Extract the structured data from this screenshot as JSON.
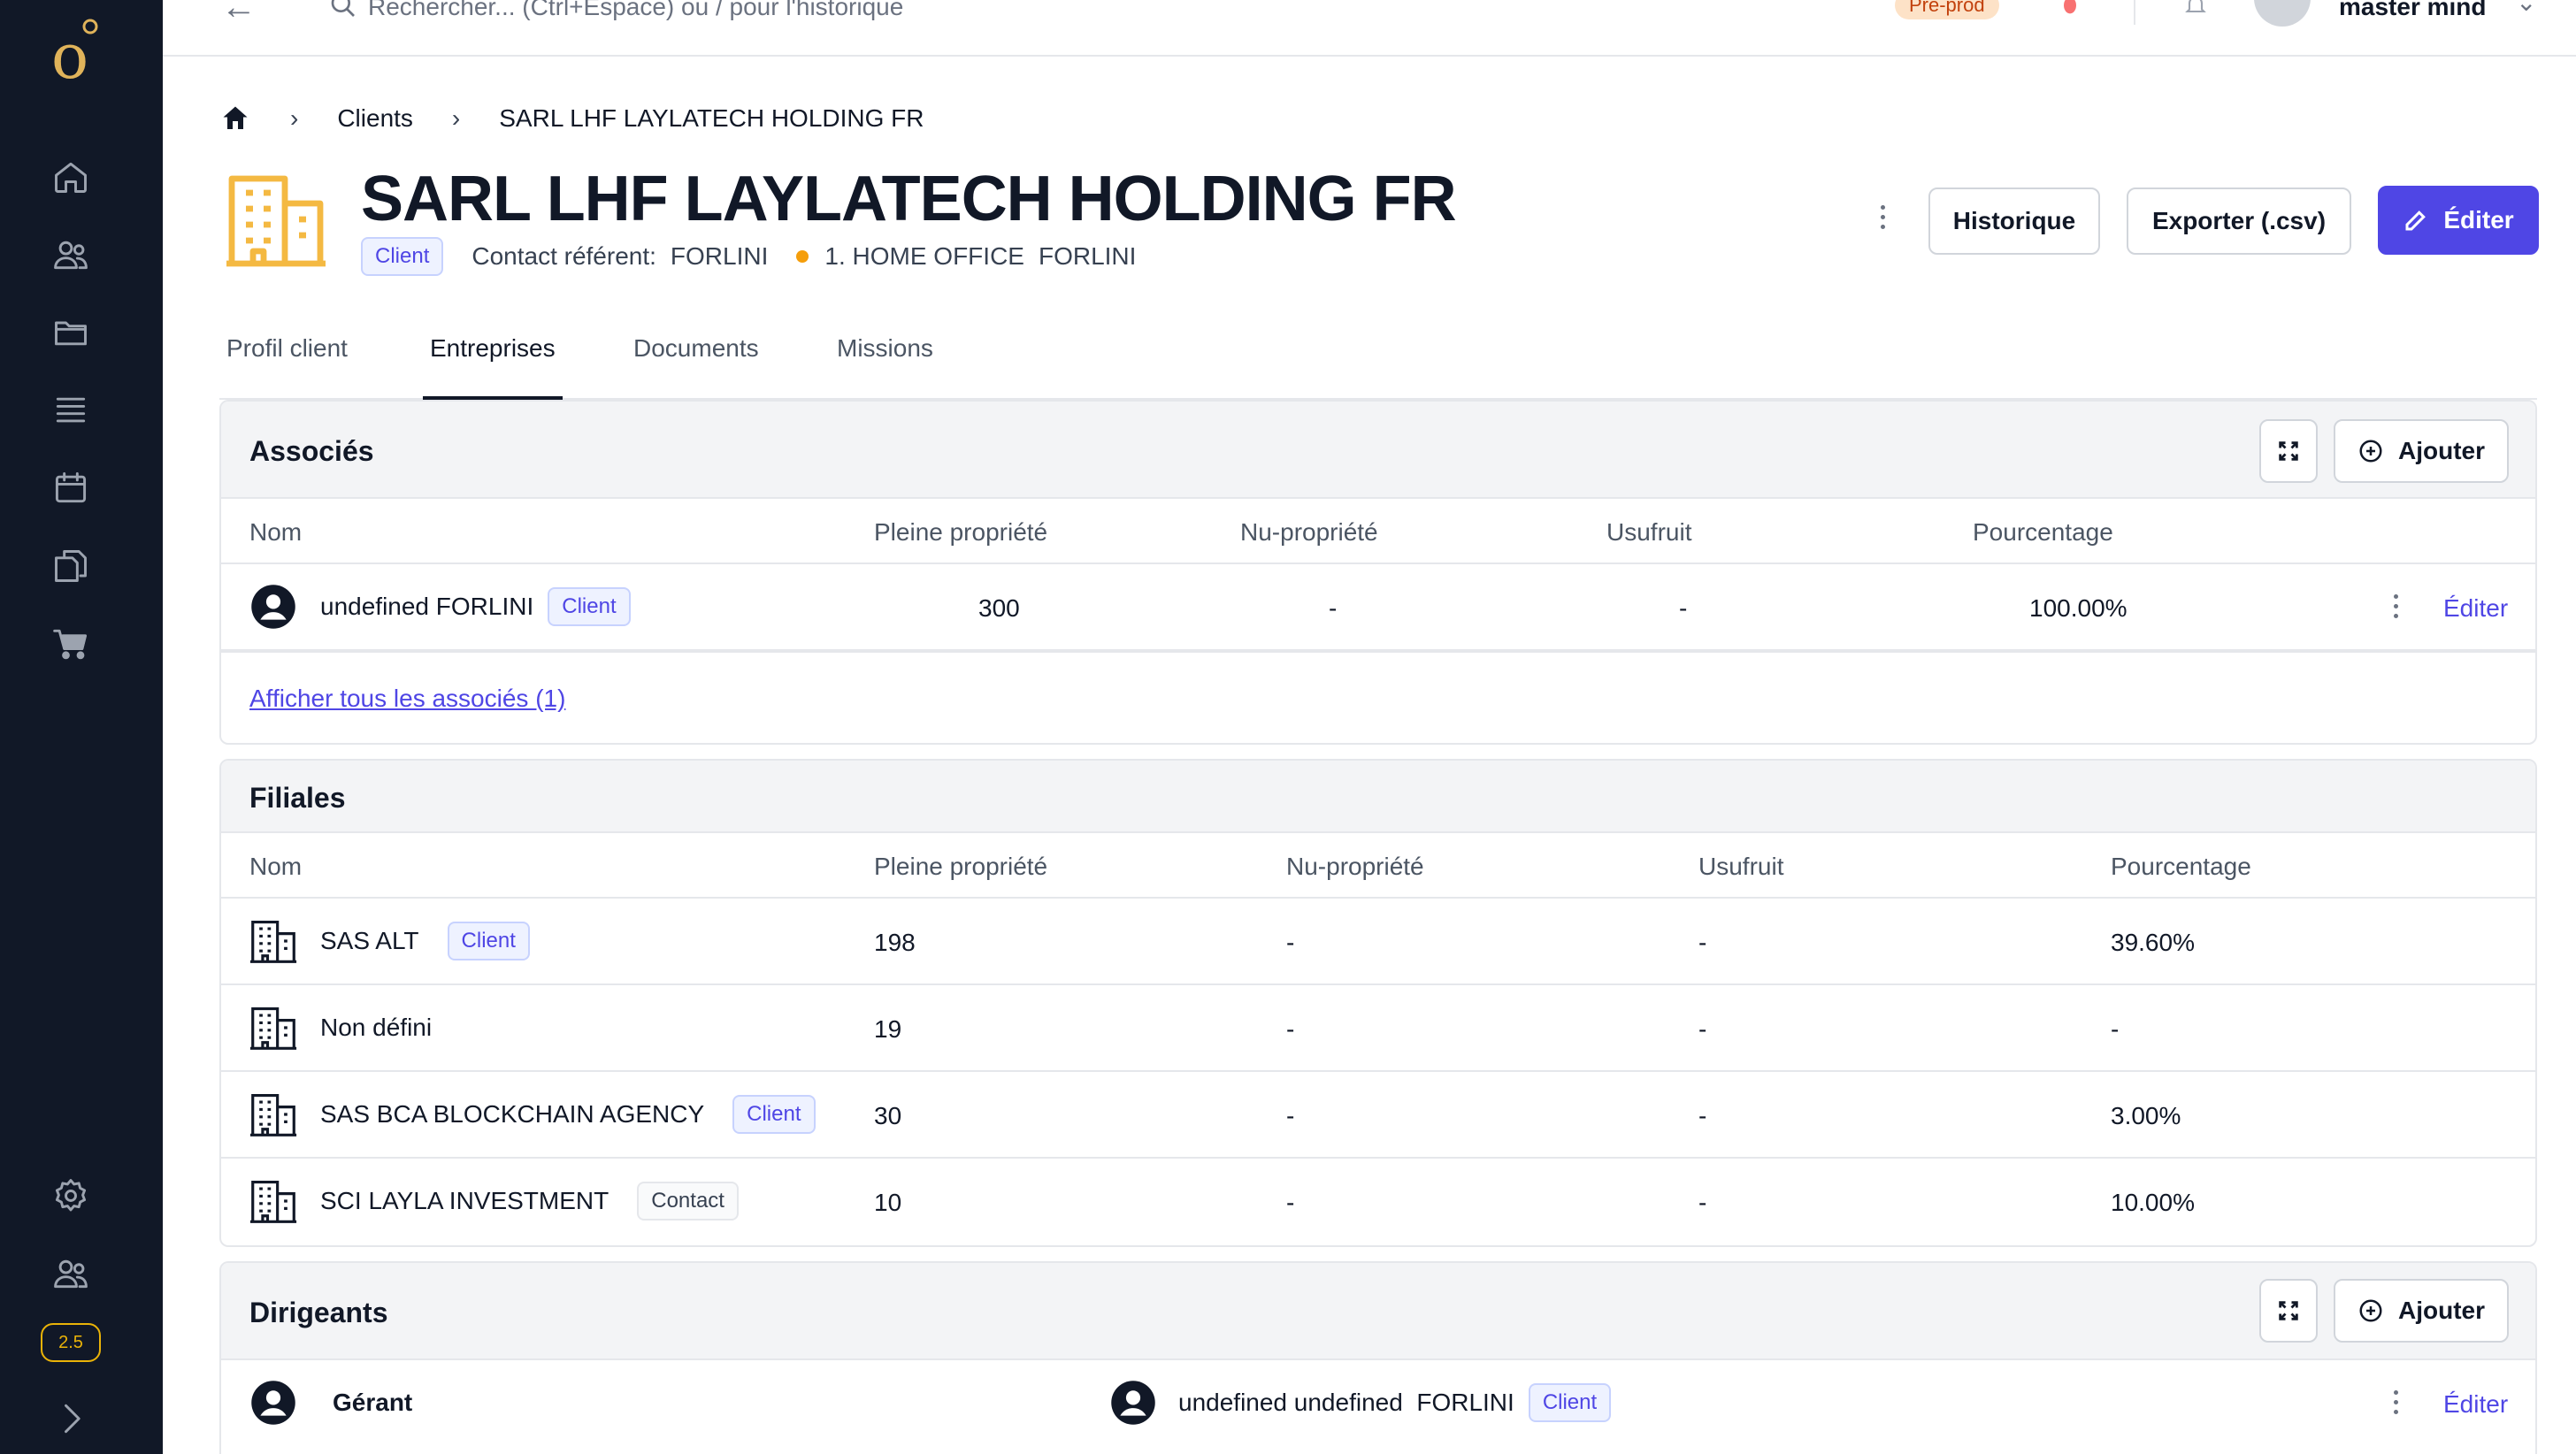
{
  "topbar": {
    "search_placeholder": "Rechercher... (Ctrl+Espace) ou / pour l'historique",
    "env_badge": "Pré-prod",
    "user_name": "master mind"
  },
  "sidebar": {
    "version": "2.5",
    "items": [
      "home-icon",
      "users-icon",
      "folder-icon",
      "list-icon",
      "calendar-icon",
      "documents-icon",
      "cart-icon",
      "gear-icon",
      "team-icon",
      "chevron-right-icon"
    ]
  },
  "breadcrumb": {
    "level1": "Clients",
    "level2": "SARL LHF LAYLATECH HOLDING FR"
  },
  "header": {
    "title": "SARL LHF LAYLATECH HOLDING FR",
    "badge": "Client",
    "contact_label": "Contact référent:",
    "contact_name": "FORLINI",
    "office_name": "1. HOME OFFICE",
    "office_person": "FORLINI",
    "btn_history": "Historique",
    "btn_export": "Exporter (.csv)",
    "btn_edit": "Éditer"
  },
  "tabs": [
    "Profil client",
    "Entreprises",
    "Documents",
    "Missions"
  ],
  "associes": {
    "title": "Associés",
    "add_label": "Ajouter",
    "columns": [
      "Nom",
      "Pleine propriété",
      "Nu-propriété",
      "Usufruit",
      "Pourcentage"
    ],
    "rows": [
      {
        "name": "undefined FORLINI",
        "badge": "Client",
        "pleine": "300",
        "nu": "-",
        "usufruit": "-",
        "pct": "100.00%",
        "action": "Éditer"
      }
    ],
    "show_all": "Afficher tous les associés (1)"
  },
  "filiales": {
    "title": "Filiales",
    "columns": [
      "Nom",
      "Pleine propriété",
      "Nu-propriété",
      "Usufruit",
      "Pourcentage"
    ],
    "rows": [
      {
        "name": "SAS ALT",
        "badge": "Client",
        "pleine": "198",
        "nu": "-",
        "usufruit": "-",
        "pct": "39.60%"
      },
      {
        "name": "Non défini",
        "badge": "",
        "pleine": "19",
        "nu": "-",
        "usufruit": "-",
        "pct": "-"
      },
      {
        "name": "SAS BCA BLOCKCHAIN AGENCY",
        "badge": "Client",
        "pleine": "30",
        "nu": "-",
        "usufruit": "-",
        "pct": "3.00%"
      },
      {
        "name": "SCI LAYLA INVESTMENT",
        "badge": "Contact",
        "pleine": "10",
        "nu": "-",
        "usufruit": "-",
        "pct": "10.00%"
      }
    ]
  },
  "dirigeants": {
    "title": "Dirigeants",
    "add_label": "Ajouter",
    "rows": [
      {
        "role": "Gérant",
        "name": "undefined undefined  FORLINI",
        "badge": "Client",
        "action": "Éditer"
      }
    ]
  },
  "colors": {
    "accent": "#4f46e5",
    "sidebar": "#111827",
    "brand_gold": "#f4b942"
  }
}
